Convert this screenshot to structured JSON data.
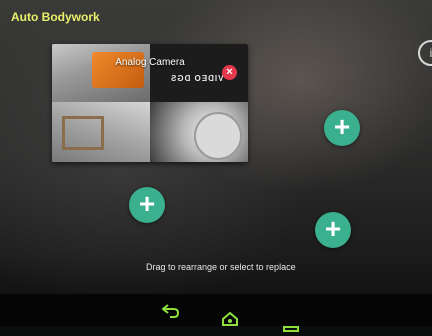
{
  "app": {
    "title": "Auto Bodywork"
  },
  "camera_tile": {
    "label": "Analog Camera",
    "mirrored_text": "VIDEO DGS",
    "close_glyph": "×"
  },
  "slots": [
    {
      "glyph": "+"
    },
    {
      "glyph": "+"
    },
    {
      "glyph": "+"
    }
  ],
  "hint_text": "Drag to rearrange or select to replace",
  "icons": {
    "corner": "info-icon",
    "back": "back-arrow-icon",
    "home": "home-icon",
    "recent": "recent-apps-icon"
  },
  "colors": {
    "title": "#e9f06a",
    "add_button": "#3bb08f",
    "close_button": "#e5384e",
    "nav_icons": "#8fe03c"
  }
}
